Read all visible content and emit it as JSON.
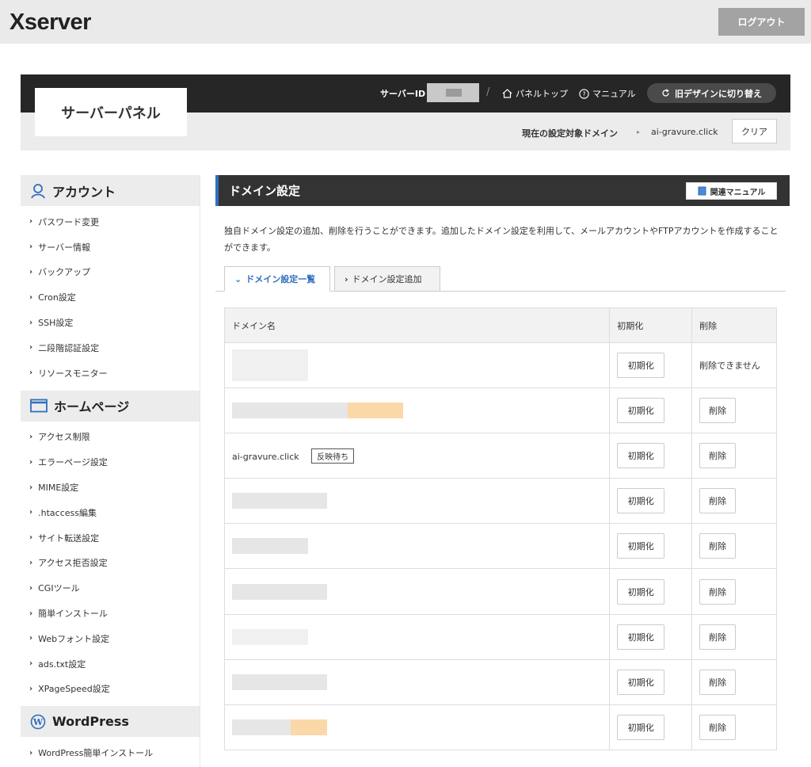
{
  "header": {
    "logo": "Xserver",
    "logout_label": "ログアウト"
  },
  "panel": {
    "title": "サーバーパネル",
    "server_id_label": "サーバーID",
    "separator": "/",
    "panel_top_label": "パネルトップ",
    "manual_label": "マニュアル",
    "switch_label": "旧デザインに切り替え",
    "target_domain_label": "現在の設定対象ドメイン",
    "target_domain_value": "ai-gravure.click",
    "clear_label": "クリア"
  },
  "sidebar": {
    "sections": [
      {
        "title": "アカウント",
        "icon": "person-icon",
        "items": [
          "パスワード変更",
          "サーバー情報",
          "バックアップ",
          "Cron設定",
          "SSH設定",
          "二段階認証設定",
          "リソースモニター"
        ]
      },
      {
        "title": "ホームページ",
        "icon": "window-icon",
        "items": [
          "アクセス制限",
          "エラーページ設定",
          "MIME設定",
          ".htaccess編集",
          "サイト転送設定",
          "アクセス拒否設定",
          "CGIツール",
          "簡単インストール",
          "Webフォント設定",
          "ads.txt設定",
          "XPageSpeed設定"
        ]
      },
      {
        "title": "WordPress",
        "icon": "wordpress-icon",
        "items": [
          "WordPress簡単インストール"
        ]
      }
    ]
  },
  "main": {
    "title": "ドメイン設定",
    "manual_button": "関連マニュアル",
    "description": "独自ドメイン設定の追加、削除を行うことができます。追加したドメイン設定を利用して、メールアカウントやFTPアカウントを作成することができます。",
    "tabs": [
      {
        "label": "ドメイン設定一覧",
        "active": true
      },
      {
        "label": "ドメイン設定追加",
        "active": false
      }
    ],
    "table": {
      "headers": [
        "ドメイン名",
        "初期化",
        "削除"
      ],
      "rows": [
        {
          "domain": "",
          "redacted": true,
          "init_label": "初期化",
          "delete_label": "削除できません",
          "deletable": false
        },
        {
          "domain": "",
          "redacted": true,
          "init_label": "初期化",
          "delete_label": "削除",
          "deletable": true
        },
        {
          "domain": "ai-gravure.click",
          "redacted": false,
          "badge": "反映待ち",
          "init_label": "初期化",
          "delete_label": "削除",
          "deletable": true
        },
        {
          "domain": "",
          "redacted": true,
          "init_label": "初期化",
          "delete_label": "削除",
          "deletable": true
        },
        {
          "domain": "",
          "redacted": true,
          "init_label": "初期化",
          "delete_label": "削除",
          "deletable": true
        },
        {
          "domain": "",
          "redacted": true,
          "init_label": "初期化",
          "delete_label": "削除",
          "deletable": true
        },
        {
          "domain": "",
          "redacted": true,
          "init_label": "初期化",
          "delete_label": "削除",
          "deletable": true
        },
        {
          "domain": "",
          "redacted": true,
          "init_label": "初期化",
          "delete_label": "削除",
          "deletable": true
        },
        {
          "domain": "",
          "redacted": true,
          "init_label": "初期化",
          "delete_label": "削除",
          "deletable": true
        }
      ]
    }
  },
  "colors": {
    "accent": "#2f6fbf",
    "dark_bar": "#262626",
    "logout_bg": "#a3a3a3"
  }
}
